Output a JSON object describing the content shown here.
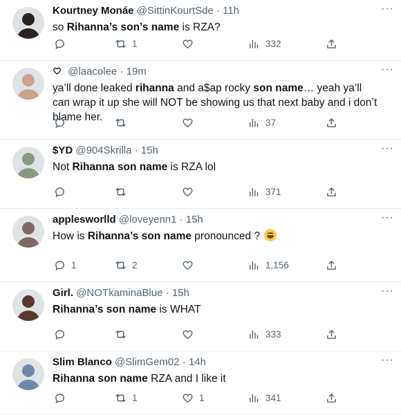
{
  "tweets": [
    {
      "name": "Kourtney Monáe",
      "handle": "@SittinKourtSde",
      "time": "11h",
      "text_parts": [
        "so ",
        "Rihanna’s son’s name",
        " is RZA?"
      ],
      "replies": "",
      "retweets": "1",
      "likes": "",
      "views": "332",
      "avatar_color": "#2b2320"
    },
    {
      "name": "",
      "handle": "@laacolee",
      "time": "19m",
      "text_parts": [
        "ya’ll done leaked ",
        "rihanna",
        " and a$ap rocky ",
        "son name",
        "… yeah ya’ll can wrap it up she will NOT be showing us that next baby and i don’t blame her."
      ],
      "replies": "",
      "retweets": "",
      "likes": "",
      "views": "37",
      "avatar_color": "#c9a38c"
    },
    {
      "name": "$YD",
      "handle": "@904Skrilla",
      "time": "15h",
      "text_parts": [
        "Not ",
        "Rihanna son name",
        " is RZA lol"
      ],
      "replies": "",
      "retweets": "",
      "likes": "",
      "views": "371",
      "avatar_color": "#8a9a7e"
    },
    {
      "name": "applesworlld",
      "handle": "@loveyenn1",
      "time": "15h",
      "text_parts": [
        "How is ",
        "Rihanna’s son name",
        " pronounced ? "
      ],
      "replies": "1",
      "retweets": "2",
      "likes": "",
      "views": "1,156",
      "avatar_color": "#7d6a66"
    },
    {
      "name": "Girl.",
      "handle": "@NOTkaminaBlue",
      "time": "15h",
      "text_parts": [
        "",
        "Rihanna’s son name",
        " is WHAT"
      ],
      "replies": "",
      "retweets": "",
      "likes": "",
      "views": "333",
      "avatar_color": "#5a3a2c"
    },
    {
      "name": "Slim Blanco",
      "handle": "@SlimGem02",
      "time": "14h",
      "text_parts": [
        "",
        "Rihanna son name",
        " RZA and I like it"
      ],
      "replies": "",
      "retweets": "1",
      "likes": "1",
      "views": "341",
      "avatar_color": "#6b88a8"
    }
  ],
  "icons": {
    "reply": "reply-icon",
    "retweet": "retweet-icon",
    "like": "heart-icon",
    "views": "views-icon",
    "share": "share-icon",
    "more": "more-icon"
  },
  "colors": {
    "text": "#0f1419",
    "muted": "#536471",
    "divider": "#e6ecf0"
  }
}
